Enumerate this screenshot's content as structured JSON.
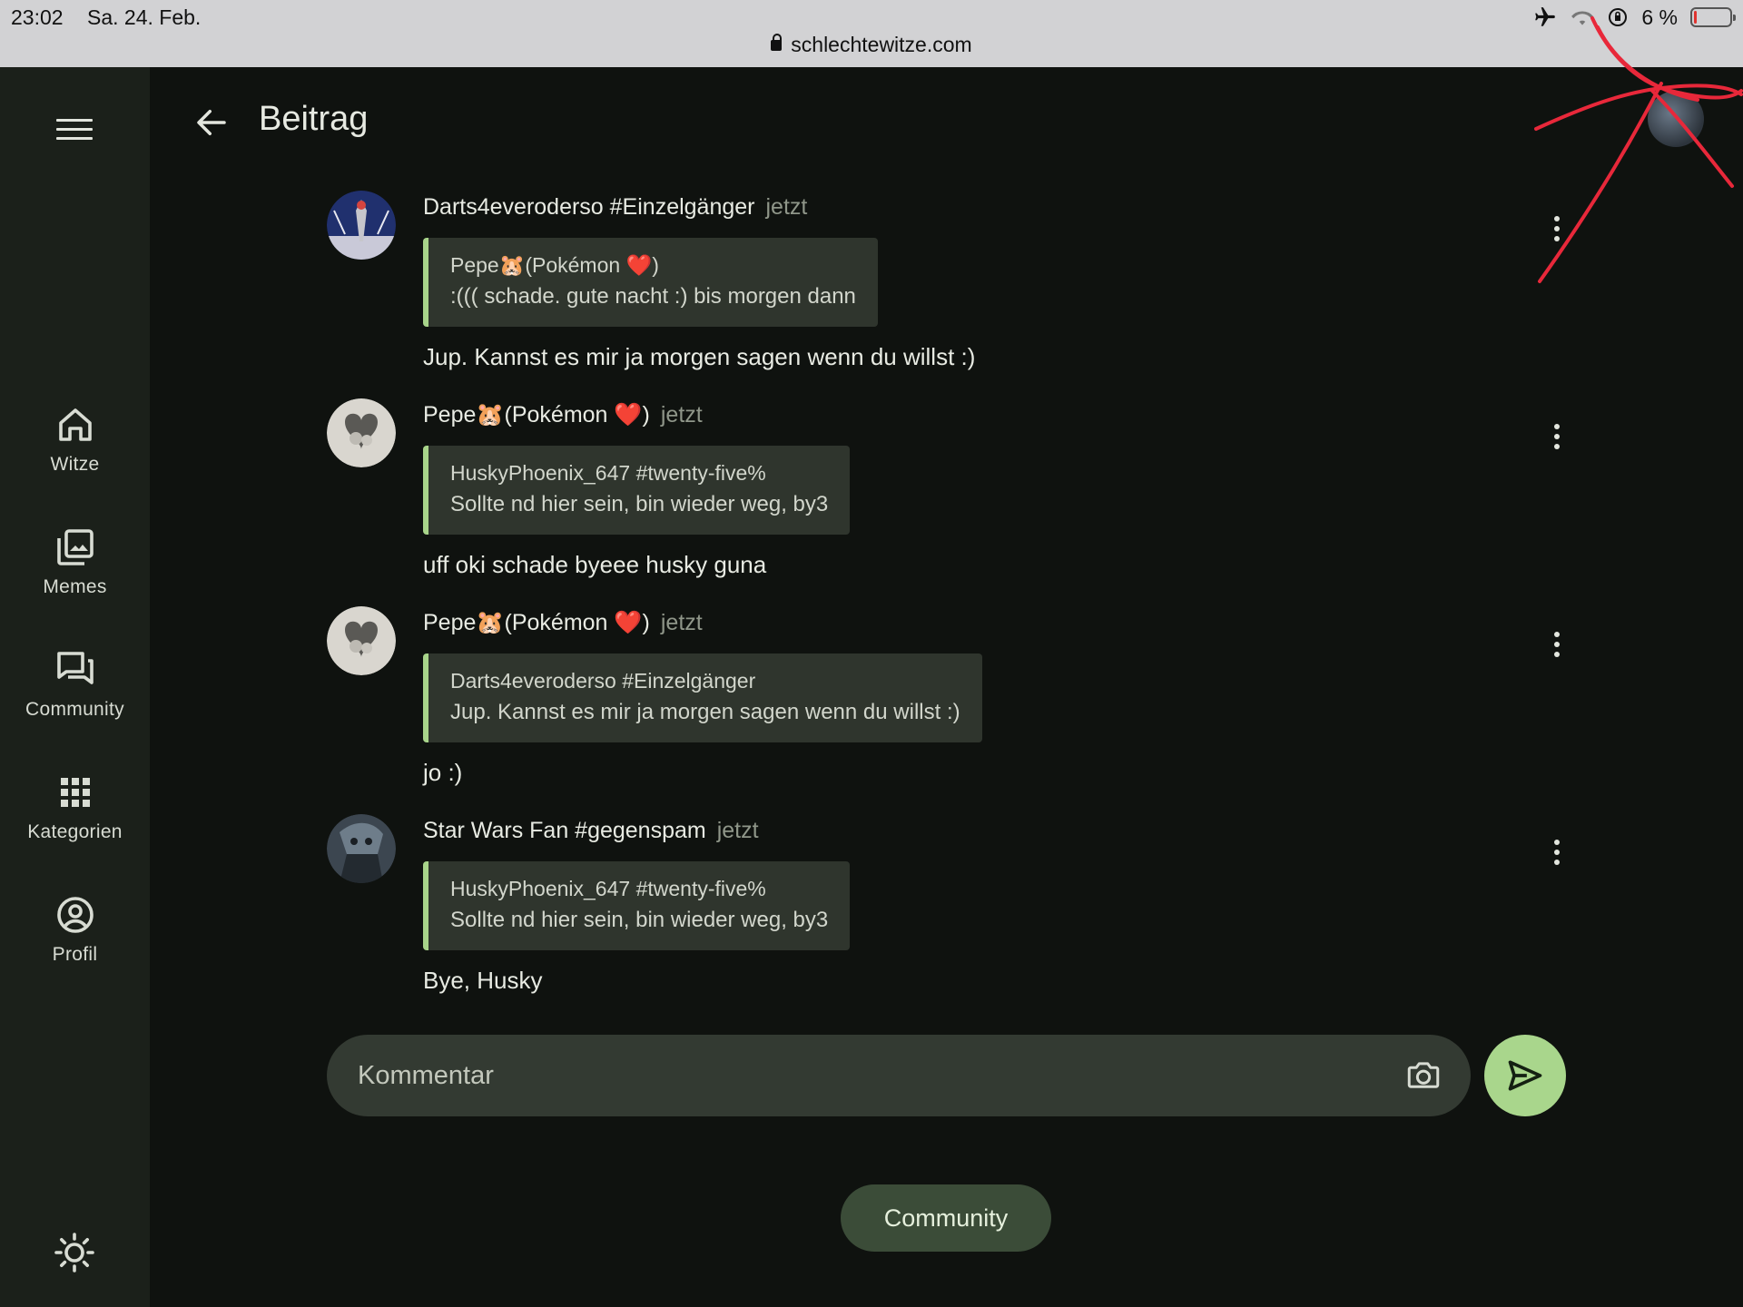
{
  "status_bar": {
    "time": "23:02",
    "date": "Sa. 24. Feb.",
    "battery": "6 %",
    "battery_level": 0.06,
    "url": "schlechtewitze.com"
  },
  "nav": {
    "items": [
      {
        "label": "Witze",
        "icon": "home-icon"
      },
      {
        "label": "Memes",
        "icon": "image-gallery-icon"
      },
      {
        "label": "Community",
        "icon": "forum-icon"
      },
      {
        "label": "Kategorien",
        "icon": "grid-apps-icon"
      },
      {
        "label": "Profil",
        "icon": "account-circle-icon"
      }
    ]
  },
  "header": {
    "title": "Beitrag"
  },
  "comments": [
    {
      "author": "Darts4everoderso #Einzelgänger",
      "time": "jetzt",
      "quote_author": "Pepe🐹(Pokémon ❤️)",
      "quote_text": ":((( schade. gute nacht :) bis morgen dann",
      "text": "Jup. Kannst es mir ja morgen sagen wenn du willst :)"
    },
    {
      "author": "Pepe🐹(Pokémon ❤️)",
      "time": "jetzt",
      "quote_author": "HuskyPhoenix_647 #twenty-five%",
      "quote_text": "Sollte nd hier sein, bin wieder weg, by3",
      "text": "uff oki schade byeee husky guna"
    },
    {
      "author": "Pepe🐹(Pokémon ❤️)",
      "time": "jetzt",
      "quote_author": "Darts4everoderso #Einzelgänger",
      "quote_text": "Jup. Kannst es mir ja morgen sagen wenn du willst :)",
      "text": "jo :)"
    },
    {
      "author": "Star Wars Fan #gegenspam",
      "time": "jetzt",
      "quote_author": "HuskyPhoenix_647 #twenty-five%",
      "quote_text": "Sollte nd hier sein, bin wieder weg, by3",
      "text": "Bye, Husky"
    }
  ],
  "composer": {
    "placeholder": "Kommentar"
  },
  "chip": {
    "label": "Community"
  },
  "colors": {
    "background": "#0f120f",
    "rail": "#1b201a",
    "quote_bar": "#a8d48a",
    "send_button": "#a9d68c",
    "chip": "#3b4c38",
    "scribble": "#e8283a"
  }
}
